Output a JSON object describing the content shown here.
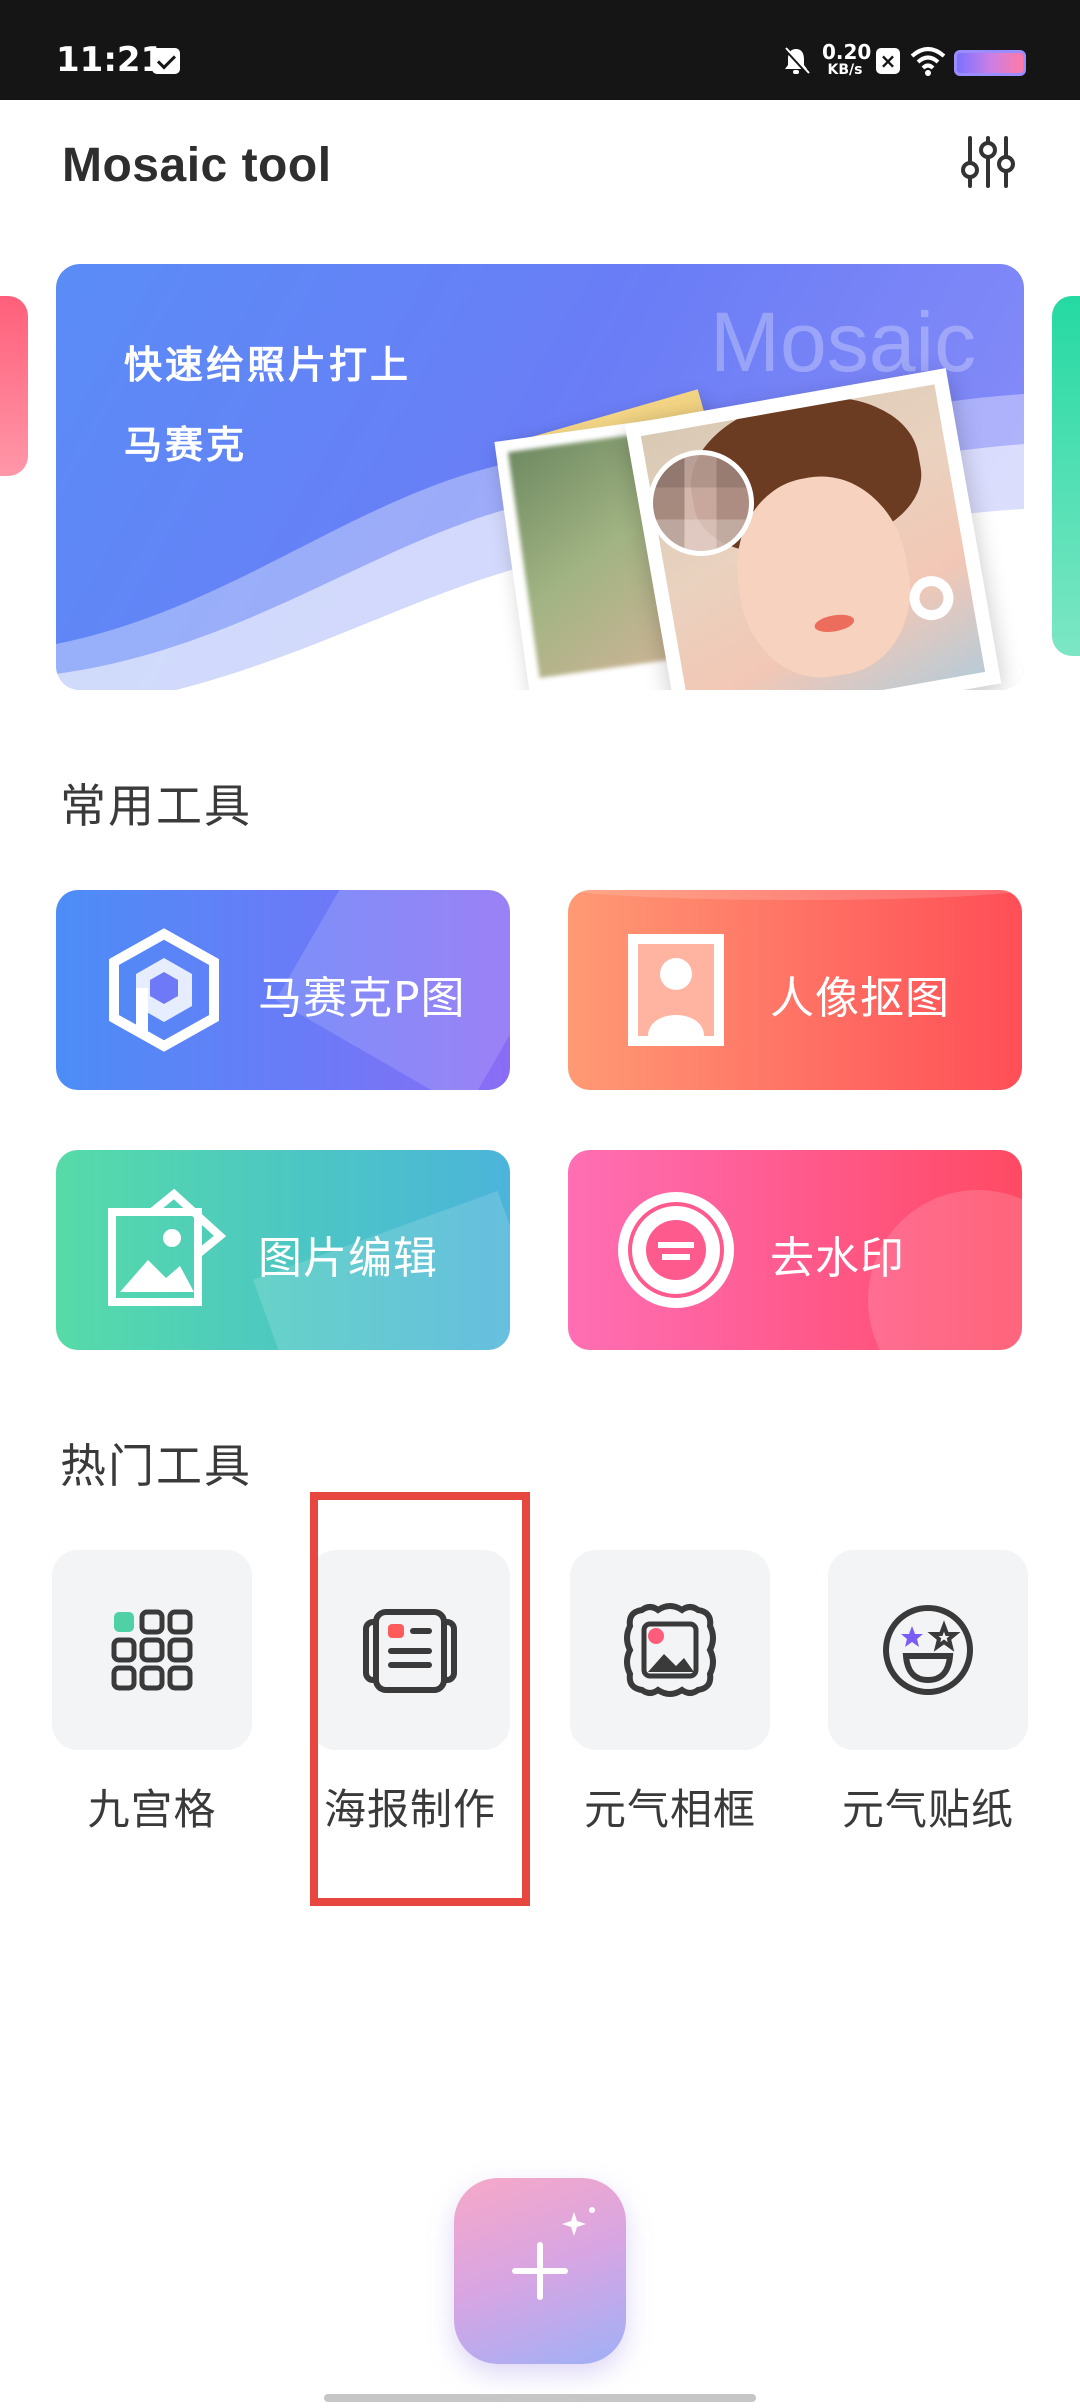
{
  "status_bar": {
    "time": "11:21",
    "net_speed_value": "0.20",
    "net_speed_unit": "KB/s",
    "x_badge": "×"
  },
  "header": {
    "title": "Mosaic tool",
    "settings_icon": "sliders-icon"
  },
  "banner": {
    "line1": "快速给照片打上",
    "line2": "马赛克",
    "watermark": "Mosaic"
  },
  "common_tools": {
    "heading": "常用工具",
    "items": [
      {
        "label": "马赛克P图",
        "icon": "hexagon-p-icon"
      },
      {
        "label": "人像抠图",
        "icon": "portrait-stamp-icon"
      },
      {
        "label": "图片编辑",
        "icon": "image-edit-icon"
      },
      {
        "label": "去水印",
        "icon": "watermark-seal-icon"
      }
    ]
  },
  "hot_tools": {
    "heading": "热门工具",
    "items": [
      {
        "label": "九宫格",
        "icon": "grid-icon"
      },
      {
        "label": "海报制作",
        "icon": "poster-icon"
      },
      {
        "label": "元气相框",
        "icon": "photo-frame-icon"
      },
      {
        "label": "元气贴纸",
        "icon": "sticker-icon"
      }
    ]
  },
  "fab": {
    "icon": "plus-sparkle-icon"
  },
  "colors": {
    "highlight": "#e8473f",
    "accent_teal": "#4fd1a5",
    "accent_purple": "#7b5cf5",
    "accent_pink": "#ff5b7a"
  }
}
